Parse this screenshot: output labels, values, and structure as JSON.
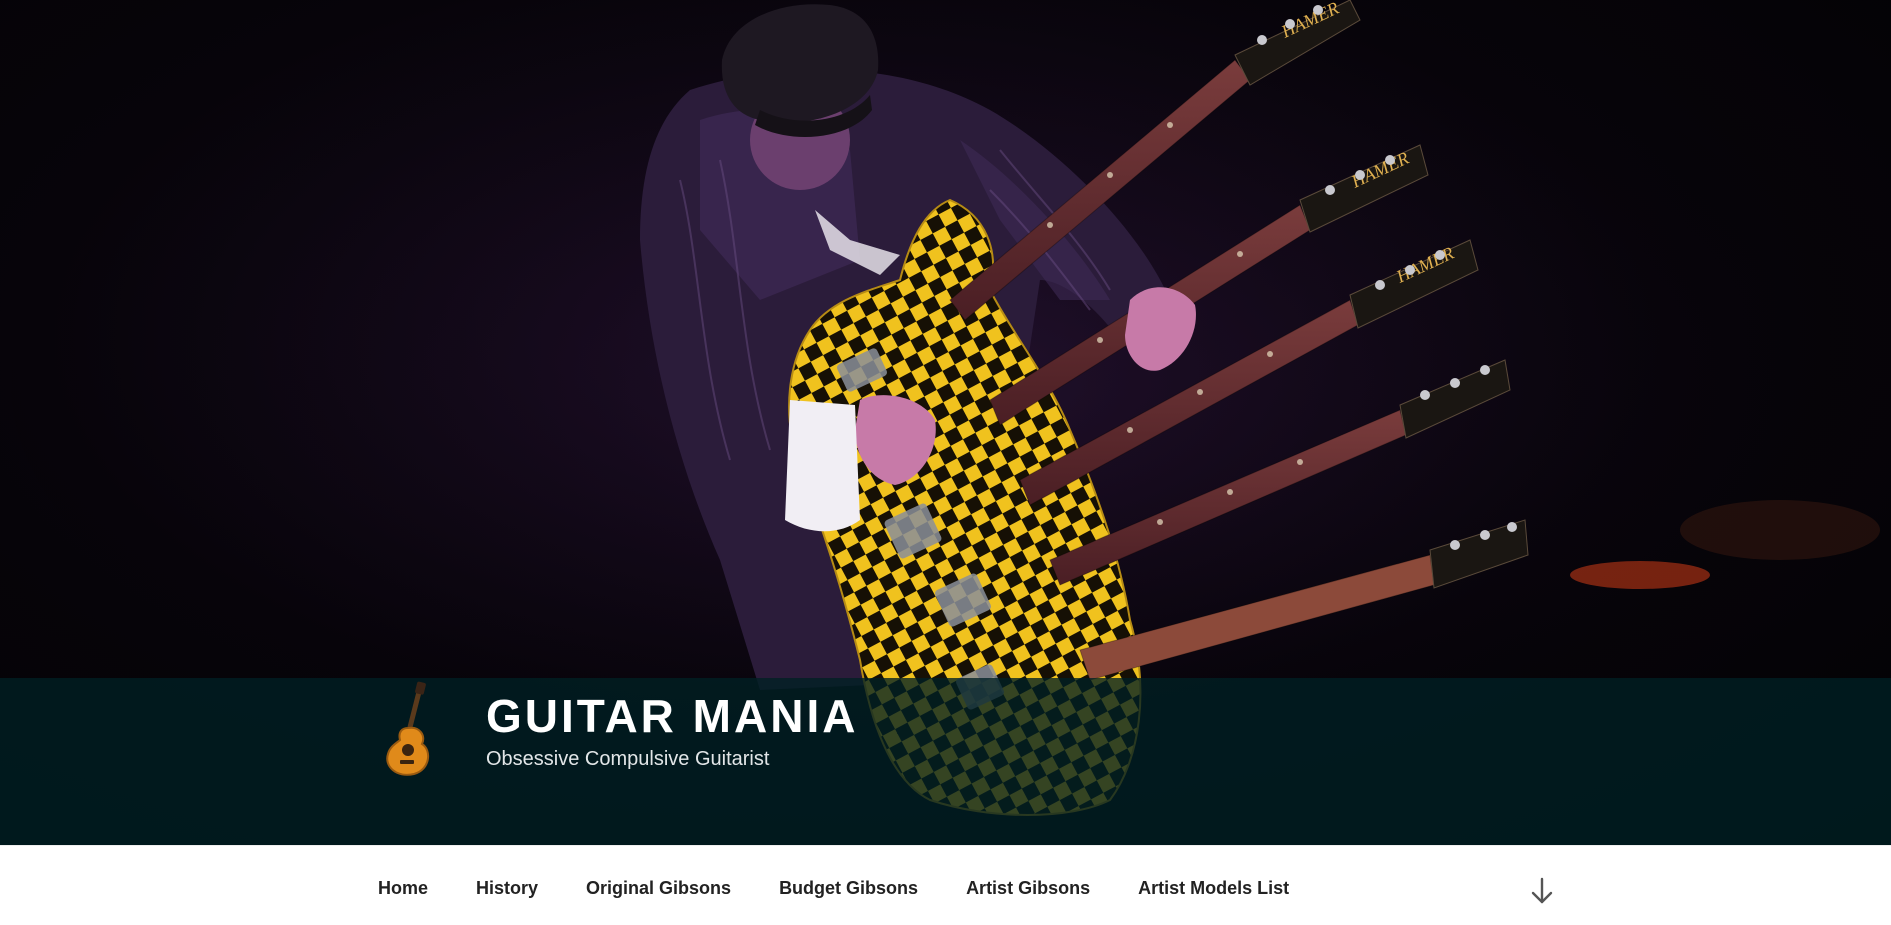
{
  "site": {
    "title": "GUITAR MANIA",
    "description": "Obsessive Compulsive Guitarist",
    "logo_icon": "guitar-icon"
  },
  "hero": {
    "image": "guitarist-with-five-neck-checkered-guitar",
    "headstock_brand": "HAMER"
  },
  "nav": {
    "items": [
      {
        "label": "Home"
      },
      {
        "label": "History"
      },
      {
        "label": "Original Gibsons"
      },
      {
        "label": "Budget Gibsons"
      },
      {
        "label": "Artist Gibsons"
      },
      {
        "label": "Artist Models List"
      }
    ],
    "scroll_icon": "arrow-down-icon"
  },
  "colors": {
    "branding_bar": "#002024",
    "nav_text": "#222222",
    "title_text": "#ffffff",
    "guitar_yellow": "#e8b820",
    "suit_purple": "#3a2150"
  }
}
